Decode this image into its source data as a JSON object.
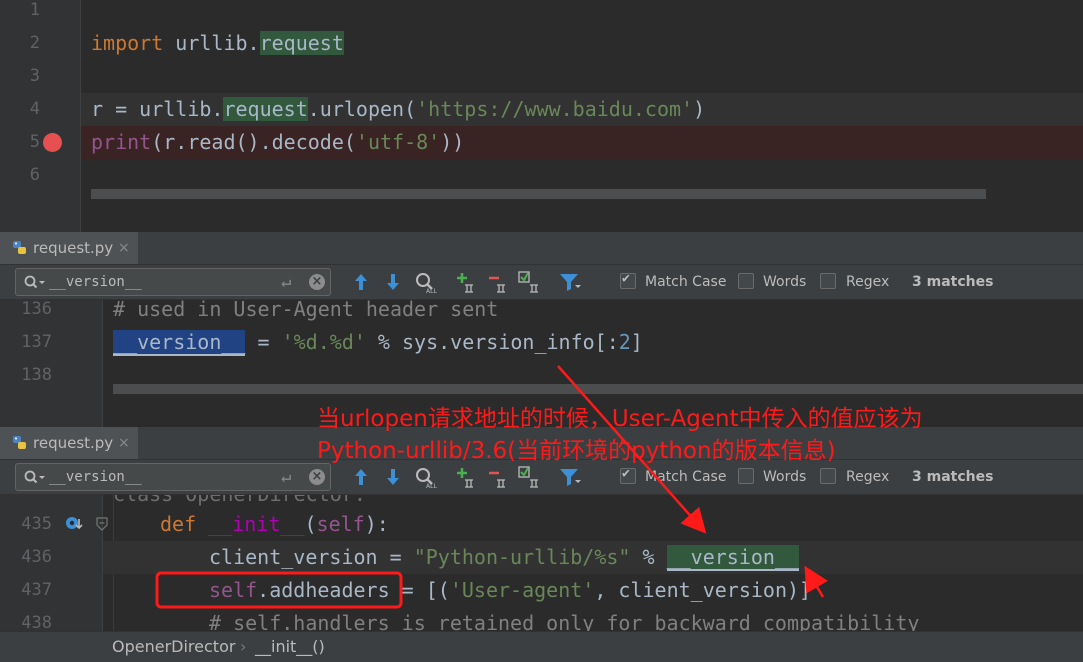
{
  "editor1": {
    "lines": [
      {
        "num": "1"
      },
      {
        "num": "2"
      },
      {
        "num": "3"
      },
      {
        "num": "4"
      },
      {
        "num": "5"
      },
      {
        "num": "6"
      }
    ],
    "code": {
      "l2_import": "import",
      "l2_rest": " urllib.",
      "l2_request": "request",
      "l4_a": "r = urllib.",
      "l4_b": "request",
      "l4_c": ".urlopen(",
      "l4_str": "'https://www.baidu.com'",
      "l4_d": ")",
      "l5_print": "print",
      "l5_a": "(r.read().decode(",
      "l5_str": "'utf-8'",
      "l5_b": "))"
    }
  },
  "panel1": {
    "tab_label": "request.py",
    "tab_close": "×",
    "find": {
      "value": "__version__",
      "enter_glyph": "↵",
      "clear_glyph": "×",
      "match_case_label": "Match Case",
      "match_case_checked": true,
      "words_label": "Words",
      "regex_label": "Regex",
      "matches": "3 matches"
    },
    "lines": [
      {
        "num": "136"
      },
      {
        "num": "137"
      },
      {
        "num": "138"
      }
    ],
    "code": {
      "l136": "# used in User-Agent header sent",
      "l137_var": "__version__",
      "l137_a": " = ",
      "l137_str": "'%d.%d'",
      "l137_b": " % sys.version_info[:",
      "l137_num": "2",
      "l137_c": "]"
    }
  },
  "panel2": {
    "tab_label": "request.py",
    "tab_close": "×",
    "find": {
      "value": "__version__",
      "enter_glyph": "↵",
      "clear_glyph": "×",
      "match_case_label": "Match Case",
      "match_case_checked": true,
      "words_label": "Words",
      "regex_label": "Regex",
      "matches": "3 matches"
    },
    "lines": [
      {
        "num": "435"
      },
      {
        "num": "436"
      },
      {
        "num": "437"
      },
      {
        "num": "438"
      }
    ],
    "code": {
      "l434_partial": "class OpenerDirector:",
      "l435_def": "def",
      "l435_fn": "__init__",
      "l435_a": "(",
      "l435_self": "self",
      "l435_b": "):",
      "l436_a": "client_version = ",
      "l436_str": "\"Python-urllib/%s\"",
      "l436_b": " % ",
      "l436_var": "__version__",
      "l437_self": "self",
      "l437_a": ".addheaders",
      "l437_b": " = [(",
      "l437_str": "'User-agent'",
      "l437_c": ", client_version)]",
      "l438": "# self.handlers is retained only for backward compatibility"
    }
  },
  "annotation": {
    "line1": "当urlopen请求地址的时候，User-Agent中传入的值应该为",
    "line2": "Python-urllib/3.6(当前环境的python的版本信息)",
    "color": "#ff1a1a"
  },
  "breadcrumb": {
    "item1": "OpenerDirector",
    "sep": "›",
    "item2": "__init__()"
  },
  "colors": {
    "background": "#2b2b2b",
    "keyword": "#cc7832",
    "string": "#6a8759",
    "comment": "#808080",
    "self": "#94558d",
    "search_highlight": "#32593d",
    "selection": "#214283",
    "breakpoint": "#e65050"
  }
}
